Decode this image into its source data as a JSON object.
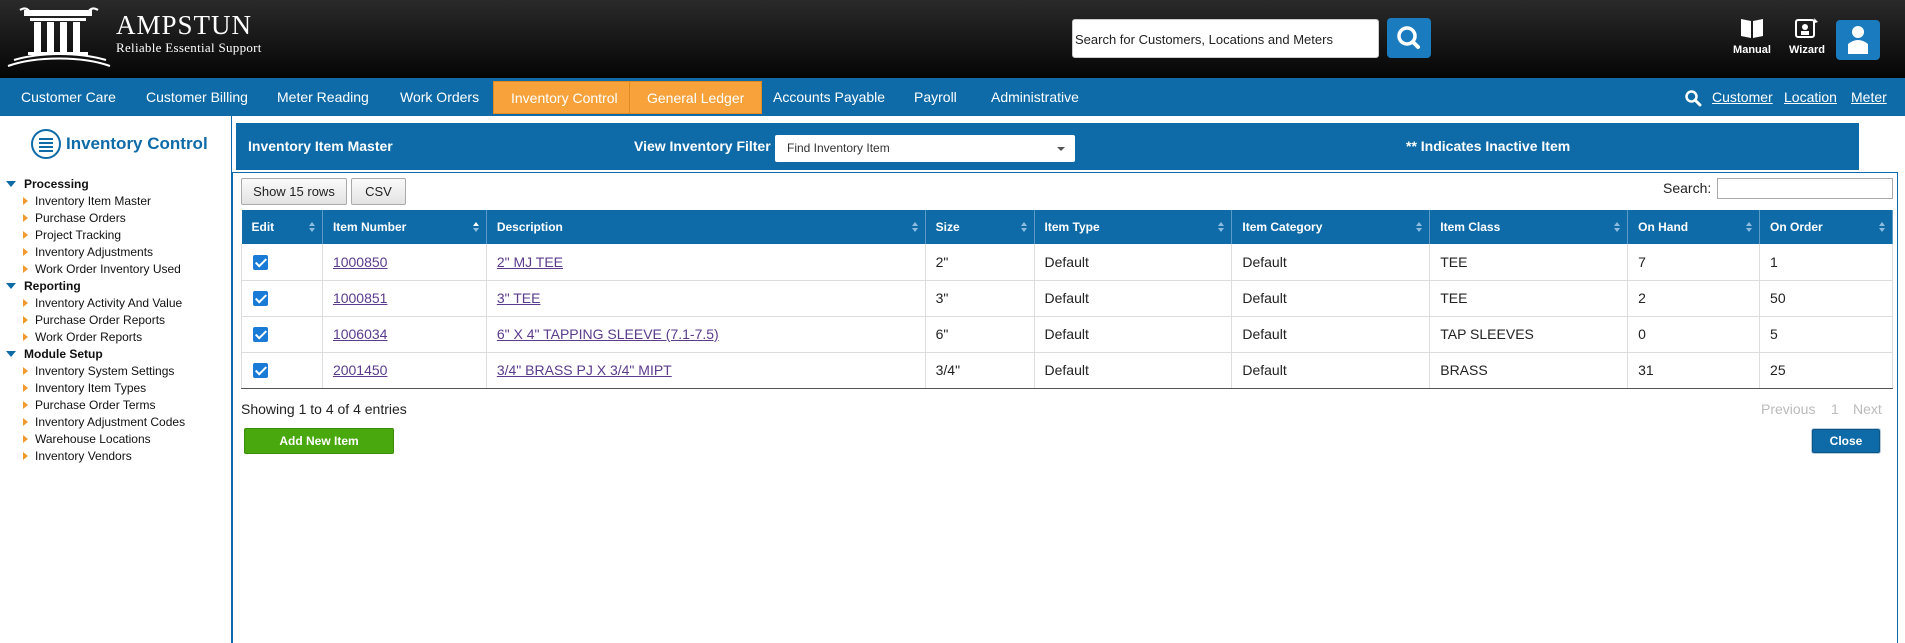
{
  "brand": {
    "name": "AMPSTUN",
    "tagline": "Reliable Essential Support"
  },
  "header": {
    "search_placeholder": "Search for Customers, Locations and Meters",
    "tools": {
      "manual": "Manual",
      "wizard": "Wizard"
    }
  },
  "nav": {
    "items": [
      "Customer Care",
      "Customer Billing",
      "Meter Reading",
      "Work Orders",
      "Inventory Control",
      "General Ledger",
      "Accounts Payable",
      "Payroll",
      "Administrative"
    ],
    "active": [
      "Inventory Control",
      "General Ledger"
    ],
    "right": [
      "Customer",
      "Location",
      "Meter"
    ]
  },
  "sidebar": {
    "title": "Inventory Control",
    "sections": [
      {
        "label": "Processing",
        "links": [
          "Inventory Item Master",
          "Purchase Orders",
          "Project Tracking",
          "Inventory Adjustments",
          "Work Order Inventory Used"
        ]
      },
      {
        "label": "Reporting",
        "links": [
          "Inventory Activity And Value",
          "Purchase Order Reports",
          "Work Order Reports"
        ]
      },
      {
        "label": "Module Setup",
        "links": [
          "Inventory System Settings",
          "Inventory Item Types",
          "Purchase Order Terms",
          "Inventory Adjustment Codes",
          "Warehouse Locations",
          "Inventory Vendors"
        ]
      }
    ]
  },
  "panel": {
    "title": "Inventory Item Master",
    "filter_label": "View Inventory Filter",
    "filter_value": "Find Inventory Item",
    "inactive_note": "** Indicates Inactive Item"
  },
  "toolbar": {
    "show_rows": "Show 15 rows",
    "csv": "CSV",
    "search_label": "Search:"
  },
  "table": {
    "columns": [
      "Edit",
      "Item Number",
      "Description",
      "Size",
      "Item Type",
      "Item Category",
      "Item Class",
      "On Hand",
      "On Order"
    ],
    "rows": [
      {
        "item_number": "1000850",
        "description": "2\" MJ TEE",
        "size": "2\"",
        "type": "Default",
        "category": "Default",
        "class": "TEE",
        "on_hand": "7",
        "on_order": "1"
      },
      {
        "item_number": "1000851",
        "description": "3\" TEE",
        "size": "3\"",
        "type": "Default",
        "category": "Default",
        "class": "TEE",
        "on_hand": "2",
        "on_order": "50"
      },
      {
        "item_number": "1006034",
        "description": "6\" X 4\" TAPPING SLEEVE (7.1-7.5)",
        "size": "6\"",
        "type": "Default",
        "category": "Default",
        "class": "TAP SLEEVES",
        "on_hand": "0",
        "on_order": "5"
      },
      {
        "item_number": "2001450",
        "description": "3/4\" BRASS PJ X 3/4\" MIPT",
        "size": "3/4\"",
        "type": "Default",
        "category": "Default",
        "class": "BRASS",
        "on_hand": "31",
        "on_order": "25"
      }
    ]
  },
  "footer": {
    "showing": "Showing 1 to 4 of 4 entries",
    "previous": "Previous",
    "page": "1",
    "next": "Next",
    "add_new": "Add New Item",
    "close": "Close"
  },
  "colors": {
    "primary": "#0e6ba8",
    "accent": "#f7a23b",
    "success": "#49a80e"
  }
}
